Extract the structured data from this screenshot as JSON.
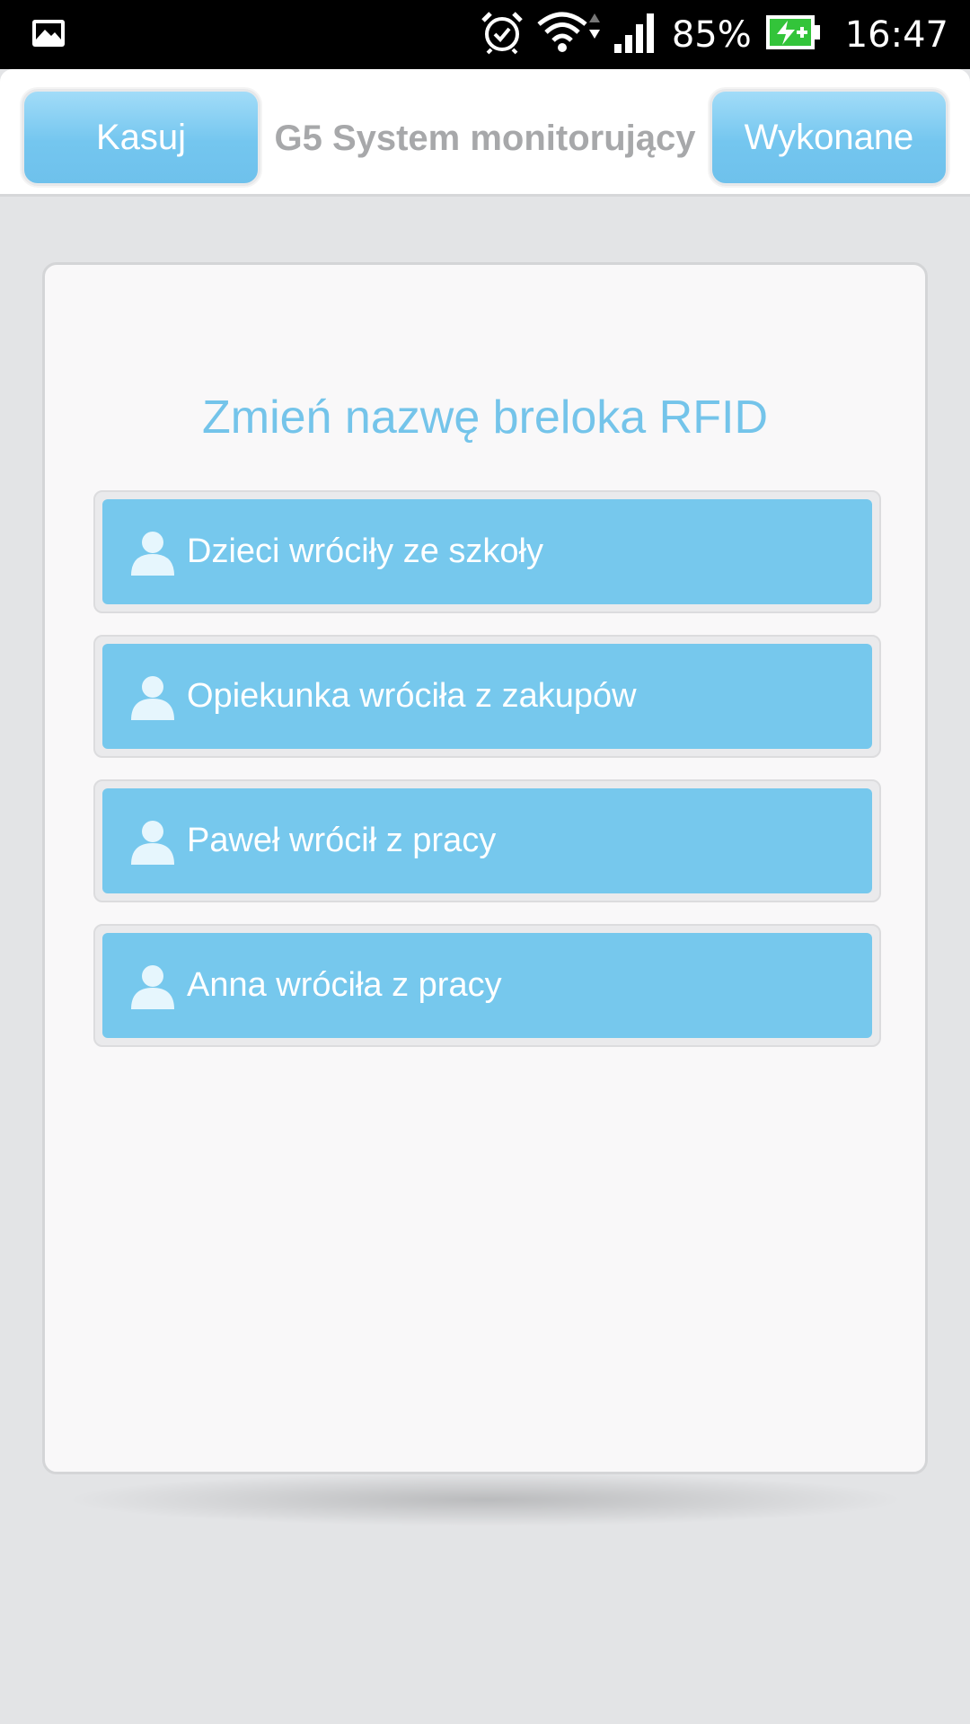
{
  "status_bar": {
    "battery_percent": "85%",
    "time": "16:47",
    "icons": [
      "image-notification-icon",
      "alarm-icon",
      "wifi-icon",
      "signal-icon",
      "battery-charging-icon"
    ]
  },
  "header": {
    "left_button": "Kasuj",
    "title": "G5 System monitorujący",
    "right_button": "Wykonane"
  },
  "card": {
    "title": "Zmień nazwę breloka RFID",
    "items": [
      {
        "label": "Dzieci wróciły ze szkoły",
        "icon": "person-icon"
      },
      {
        "label": "Opiekunka wróciła z zakupów",
        "icon": "person-icon"
      },
      {
        "label": "Paweł wrócił z pracy",
        "icon": "person-icon"
      },
      {
        "label": "Anna wróciła z pracy",
        "icon": "person-icon"
      }
    ]
  },
  "colors": {
    "accent": "#76c8ed",
    "title_text": "#74c4ea",
    "header_title": "#a7a8aa",
    "background": "#e3e4e6",
    "battery": "#33c43a"
  }
}
